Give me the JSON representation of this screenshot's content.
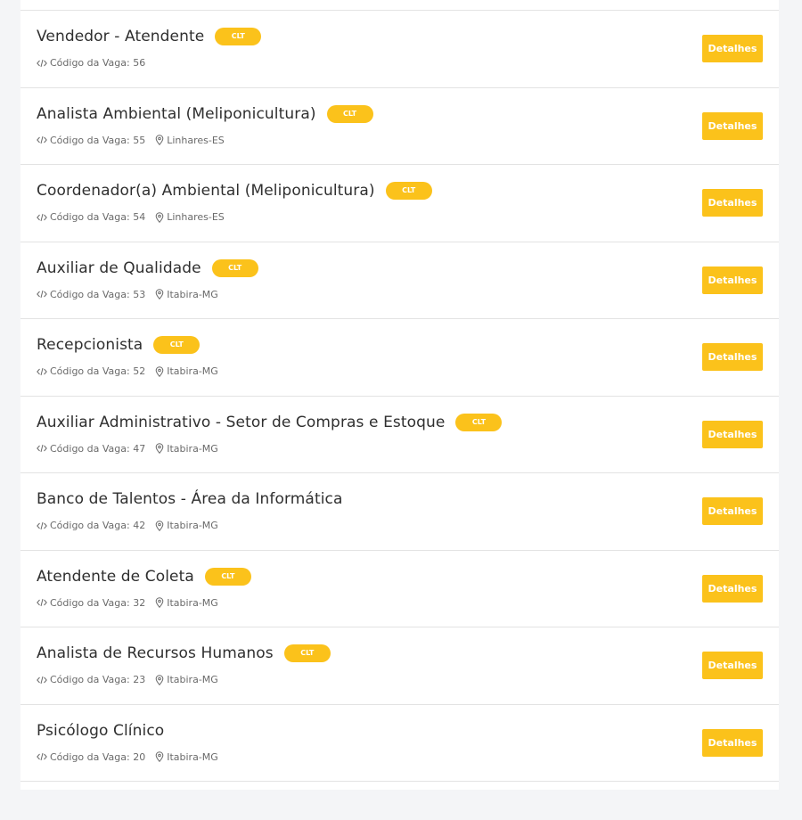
{
  "jobs": [
    {
      "title": "Vendedor - Atendente",
      "badge": "CLT",
      "code_label": "Código da Vaga: 56",
      "location": ""
    },
    {
      "title": "Analista Ambiental (Meliponicultura)",
      "badge": "CLT",
      "code_label": "Código da Vaga: 55",
      "location": "Linhares-ES"
    },
    {
      "title": "Coordenador(a) Ambiental (Meliponicultura)",
      "badge": "CLT",
      "code_label": "Código da Vaga: 54",
      "location": "Linhares-ES"
    },
    {
      "title": "Auxiliar de Qualidade",
      "badge": "CLT",
      "code_label": "Código da Vaga: 53",
      "location": "Itabira-MG"
    },
    {
      "title": "Recepcionista",
      "badge": "CLT",
      "code_label": "Código da Vaga: 52",
      "location": "Itabira-MG"
    },
    {
      "title": "Auxiliar Administrativo - Setor de Compras e Estoque",
      "badge": "CLT",
      "code_label": "Código da Vaga: 47",
      "location": "Itabira-MG"
    },
    {
      "title": "Banco de Talentos - Área da Informática",
      "badge": "",
      "code_label": "Código da Vaga: 42",
      "location": "Itabira-MG"
    },
    {
      "title": "Atendente de Coleta",
      "badge": "CLT",
      "code_label": "Código da Vaga: 32",
      "location": "Itabira-MG"
    },
    {
      "title": "Analista de Recursos Humanos",
      "badge": "CLT",
      "code_label": "Código da Vaga: 23",
      "location": "Itabira-MG"
    },
    {
      "title": "Psicólogo Clínico",
      "badge": "",
      "code_label": "Código da Vaga: 20",
      "location": "Itabira-MG"
    }
  ],
  "details_label": "Detalhes",
  "icons": {
    "code": "code-icon",
    "location": "location-pin-icon"
  },
  "colors": {
    "accent": "#fbc21b",
    "title_text": "#2f2f2f",
    "meta_text": "#6a6a6a",
    "divider": "#e3e3e3",
    "page_background": "#f4f5f7"
  }
}
